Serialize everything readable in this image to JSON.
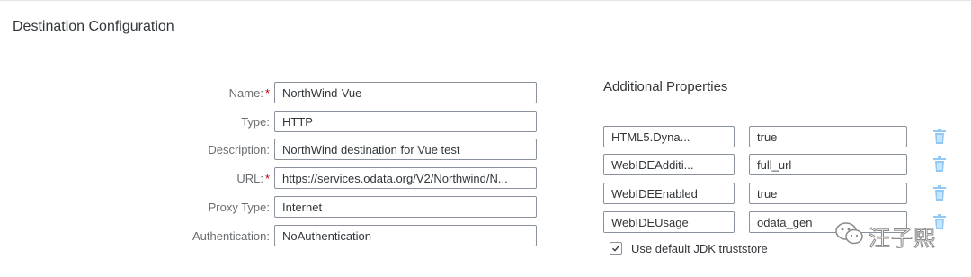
{
  "page": {
    "title": "Destination Configuration"
  },
  "form": {
    "name_label": "Name:",
    "name_value": "NorthWind-Vue",
    "type_label": "Type:",
    "type_value": "HTTP",
    "description_label": "Description:",
    "description_value": "NorthWind destination for Vue test",
    "url_label": "URL:",
    "url_value": "https://services.odata.org/V2/Northwind/N...",
    "proxy_label": "Proxy Type:",
    "proxy_value": "Internet",
    "auth_label": "Authentication:",
    "auth_value": "NoAuthentication",
    "required_marker": "*"
  },
  "properties": {
    "title": "Additional Properties",
    "rows": [
      {
        "key": "HTML5.Dyna...",
        "value": "true"
      },
      {
        "key": "WebIDEAdditi...",
        "value": "full_url"
      },
      {
        "key": "WebIDEEnabled",
        "value": "true"
      },
      {
        "key": "WebIDEUsage",
        "value": "odata_gen"
      }
    ],
    "truststore_label": "Use default JDK truststore",
    "truststore_checked": true
  },
  "watermark": {
    "text": "汪子熙",
    "icon": "wechat-icon"
  },
  "colors": {
    "required": "#bb0000",
    "trash_icon": "#91c8f6",
    "border": "#89919a"
  }
}
